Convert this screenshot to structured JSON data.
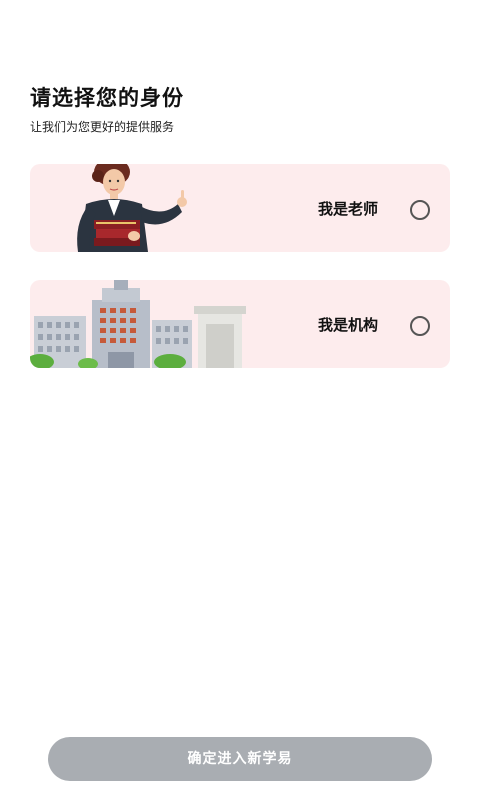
{
  "header": {
    "title": "请选择您的身份",
    "subtitle": "让我们为您更好的提供服务"
  },
  "options": [
    {
      "label": "我是老师",
      "selected": false,
      "illustration": "teacher-illustration"
    },
    {
      "label": "我是机构",
      "selected": false,
      "illustration": "building-illustration"
    }
  ],
  "footer": {
    "confirm_label": "确定进入新学易"
  },
  "colors": {
    "card_bg": "#fdeced",
    "button_disabled": "#a9adb2",
    "radio_border": "#555555"
  }
}
